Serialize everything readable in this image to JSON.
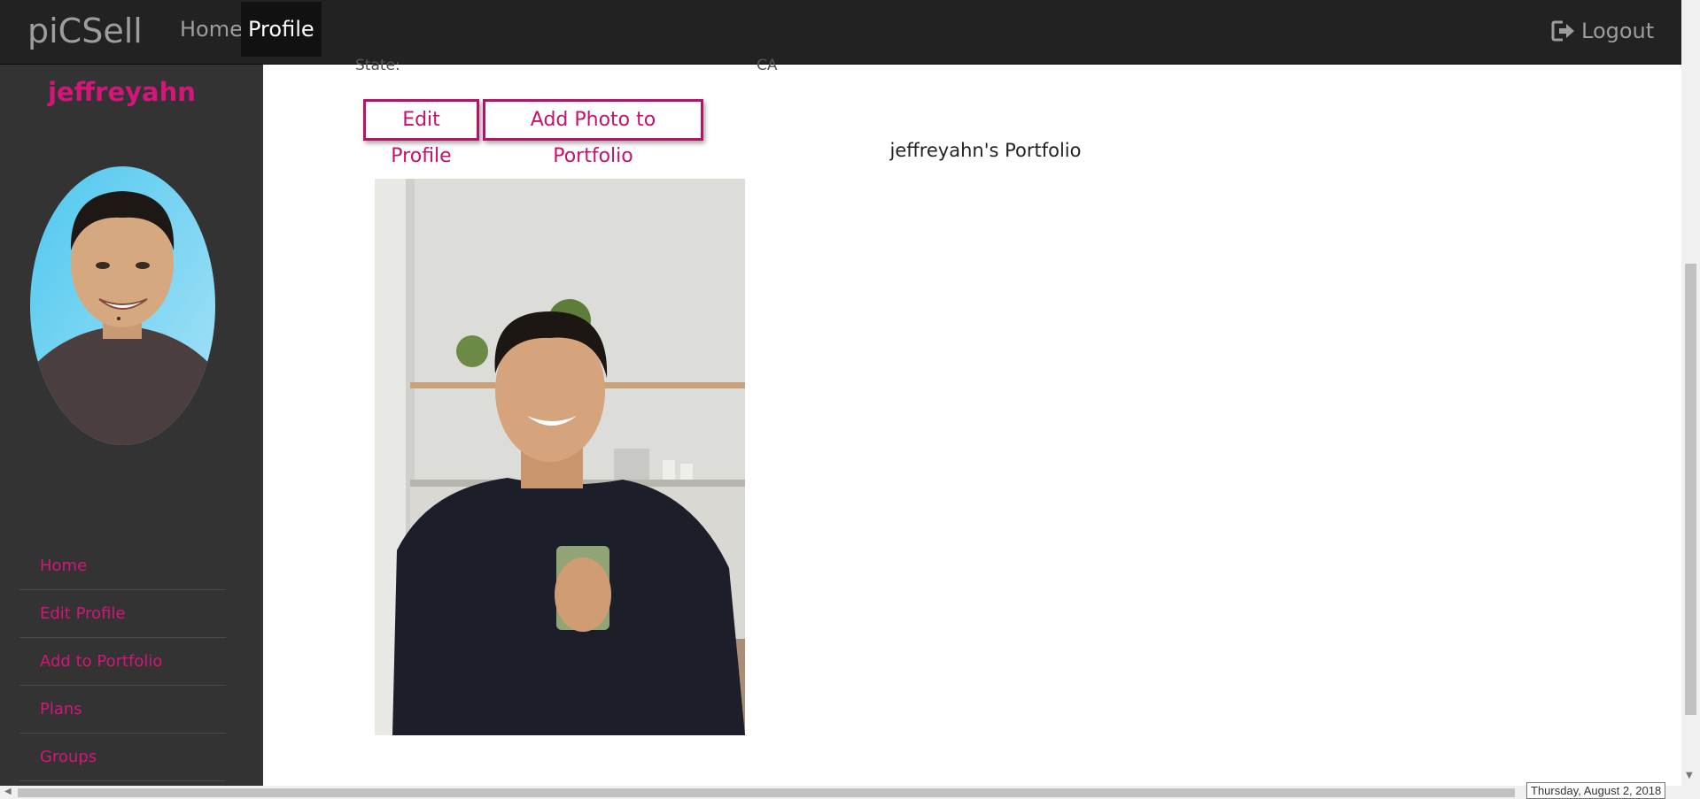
{
  "navbar": {
    "brand": "piCSell",
    "links": [
      {
        "label": "Home"
      },
      {
        "label": "Profile"
      }
    ],
    "logout_label": "Logout"
  },
  "sidebar": {
    "username": "jeffreyahn",
    "menu": [
      {
        "label": "Home"
      },
      {
        "label": "Edit Profile"
      },
      {
        "label": "Add to Portfolio"
      },
      {
        "label": "Plans"
      },
      {
        "label": "Groups"
      }
    ]
  },
  "profile": {
    "state_label": "State:",
    "state_value": "CA",
    "edit_profile_label": "Edit Profile",
    "add_photo_label": "Add Photo to Portfolio",
    "portfolio_title": "jeffreyahn's Portfolio"
  },
  "status": {
    "date_tooltip": "Thursday, August 2, 2018"
  },
  "colors": {
    "accent": "#d4157a",
    "navbar": "#222222",
    "sidebar": "#333333"
  },
  "icons": {
    "logout": "logout-icon",
    "scroll_down": "chevron-down-icon",
    "scroll_left": "chevron-left-icon"
  }
}
